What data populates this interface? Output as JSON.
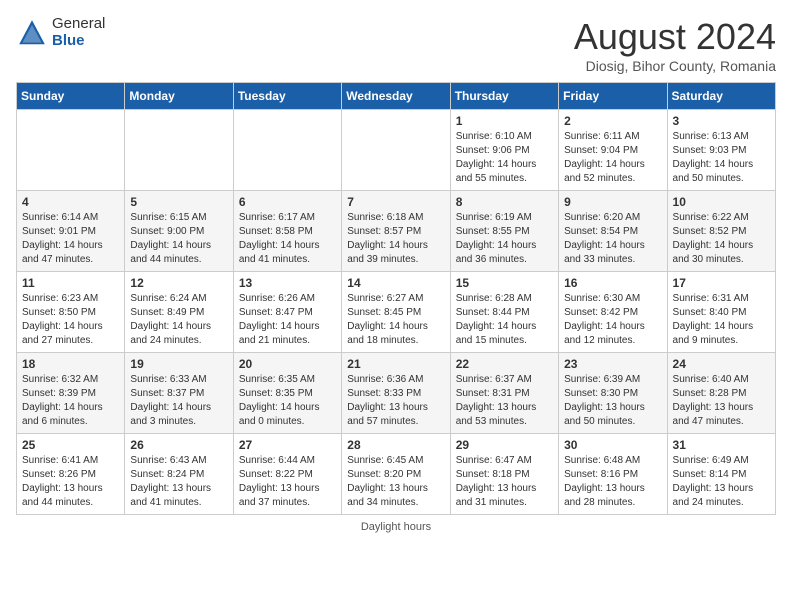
{
  "header": {
    "logo_general": "General",
    "logo_blue": "Blue",
    "month_title": "August 2024",
    "subtitle": "Diosig, Bihor County, Romania"
  },
  "days_of_week": [
    "Sunday",
    "Monday",
    "Tuesday",
    "Wednesday",
    "Thursday",
    "Friday",
    "Saturday"
  ],
  "weeks": [
    [
      {
        "day": "",
        "info": ""
      },
      {
        "day": "",
        "info": ""
      },
      {
        "day": "",
        "info": ""
      },
      {
        "day": "",
        "info": ""
      },
      {
        "day": "1",
        "info": "Sunrise: 6:10 AM\nSunset: 9:06 PM\nDaylight: 14 hours\nand 55 minutes."
      },
      {
        "day": "2",
        "info": "Sunrise: 6:11 AM\nSunset: 9:04 PM\nDaylight: 14 hours\nand 52 minutes."
      },
      {
        "day": "3",
        "info": "Sunrise: 6:13 AM\nSunset: 9:03 PM\nDaylight: 14 hours\nand 50 minutes."
      }
    ],
    [
      {
        "day": "4",
        "info": "Sunrise: 6:14 AM\nSunset: 9:01 PM\nDaylight: 14 hours\nand 47 minutes."
      },
      {
        "day": "5",
        "info": "Sunrise: 6:15 AM\nSunset: 9:00 PM\nDaylight: 14 hours\nand 44 minutes."
      },
      {
        "day": "6",
        "info": "Sunrise: 6:17 AM\nSunset: 8:58 PM\nDaylight: 14 hours\nand 41 minutes."
      },
      {
        "day": "7",
        "info": "Sunrise: 6:18 AM\nSunset: 8:57 PM\nDaylight: 14 hours\nand 39 minutes."
      },
      {
        "day": "8",
        "info": "Sunrise: 6:19 AM\nSunset: 8:55 PM\nDaylight: 14 hours\nand 36 minutes."
      },
      {
        "day": "9",
        "info": "Sunrise: 6:20 AM\nSunset: 8:54 PM\nDaylight: 14 hours\nand 33 minutes."
      },
      {
        "day": "10",
        "info": "Sunrise: 6:22 AM\nSunset: 8:52 PM\nDaylight: 14 hours\nand 30 minutes."
      }
    ],
    [
      {
        "day": "11",
        "info": "Sunrise: 6:23 AM\nSunset: 8:50 PM\nDaylight: 14 hours\nand 27 minutes."
      },
      {
        "day": "12",
        "info": "Sunrise: 6:24 AM\nSunset: 8:49 PM\nDaylight: 14 hours\nand 24 minutes."
      },
      {
        "day": "13",
        "info": "Sunrise: 6:26 AM\nSunset: 8:47 PM\nDaylight: 14 hours\nand 21 minutes."
      },
      {
        "day": "14",
        "info": "Sunrise: 6:27 AM\nSunset: 8:45 PM\nDaylight: 14 hours\nand 18 minutes."
      },
      {
        "day": "15",
        "info": "Sunrise: 6:28 AM\nSunset: 8:44 PM\nDaylight: 14 hours\nand 15 minutes."
      },
      {
        "day": "16",
        "info": "Sunrise: 6:30 AM\nSunset: 8:42 PM\nDaylight: 14 hours\nand 12 minutes."
      },
      {
        "day": "17",
        "info": "Sunrise: 6:31 AM\nSunset: 8:40 PM\nDaylight: 14 hours\nand 9 minutes."
      }
    ],
    [
      {
        "day": "18",
        "info": "Sunrise: 6:32 AM\nSunset: 8:39 PM\nDaylight: 14 hours\nand 6 minutes."
      },
      {
        "day": "19",
        "info": "Sunrise: 6:33 AM\nSunset: 8:37 PM\nDaylight: 14 hours\nand 3 minutes."
      },
      {
        "day": "20",
        "info": "Sunrise: 6:35 AM\nSunset: 8:35 PM\nDaylight: 14 hours\nand 0 minutes."
      },
      {
        "day": "21",
        "info": "Sunrise: 6:36 AM\nSunset: 8:33 PM\nDaylight: 13 hours\nand 57 minutes."
      },
      {
        "day": "22",
        "info": "Sunrise: 6:37 AM\nSunset: 8:31 PM\nDaylight: 13 hours\nand 53 minutes."
      },
      {
        "day": "23",
        "info": "Sunrise: 6:39 AM\nSunset: 8:30 PM\nDaylight: 13 hours\nand 50 minutes."
      },
      {
        "day": "24",
        "info": "Sunrise: 6:40 AM\nSunset: 8:28 PM\nDaylight: 13 hours\nand 47 minutes."
      }
    ],
    [
      {
        "day": "25",
        "info": "Sunrise: 6:41 AM\nSunset: 8:26 PM\nDaylight: 13 hours\nand 44 minutes."
      },
      {
        "day": "26",
        "info": "Sunrise: 6:43 AM\nSunset: 8:24 PM\nDaylight: 13 hours\nand 41 minutes."
      },
      {
        "day": "27",
        "info": "Sunrise: 6:44 AM\nSunset: 8:22 PM\nDaylight: 13 hours\nand 37 minutes."
      },
      {
        "day": "28",
        "info": "Sunrise: 6:45 AM\nSunset: 8:20 PM\nDaylight: 13 hours\nand 34 minutes."
      },
      {
        "day": "29",
        "info": "Sunrise: 6:47 AM\nSunset: 8:18 PM\nDaylight: 13 hours\nand 31 minutes."
      },
      {
        "day": "30",
        "info": "Sunrise: 6:48 AM\nSunset: 8:16 PM\nDaylight: 13 hours\nand 28 minutes."
      },
      {
        "day": "31",
        "info": "Sunrise: 6:49 AM\nSunset: 8:14 PM\nDaylight: 13 hours\nand 24 minutes."
      }
    ]
  ],
  "footer": {
    "note": "Daylight hours"
  }
}
